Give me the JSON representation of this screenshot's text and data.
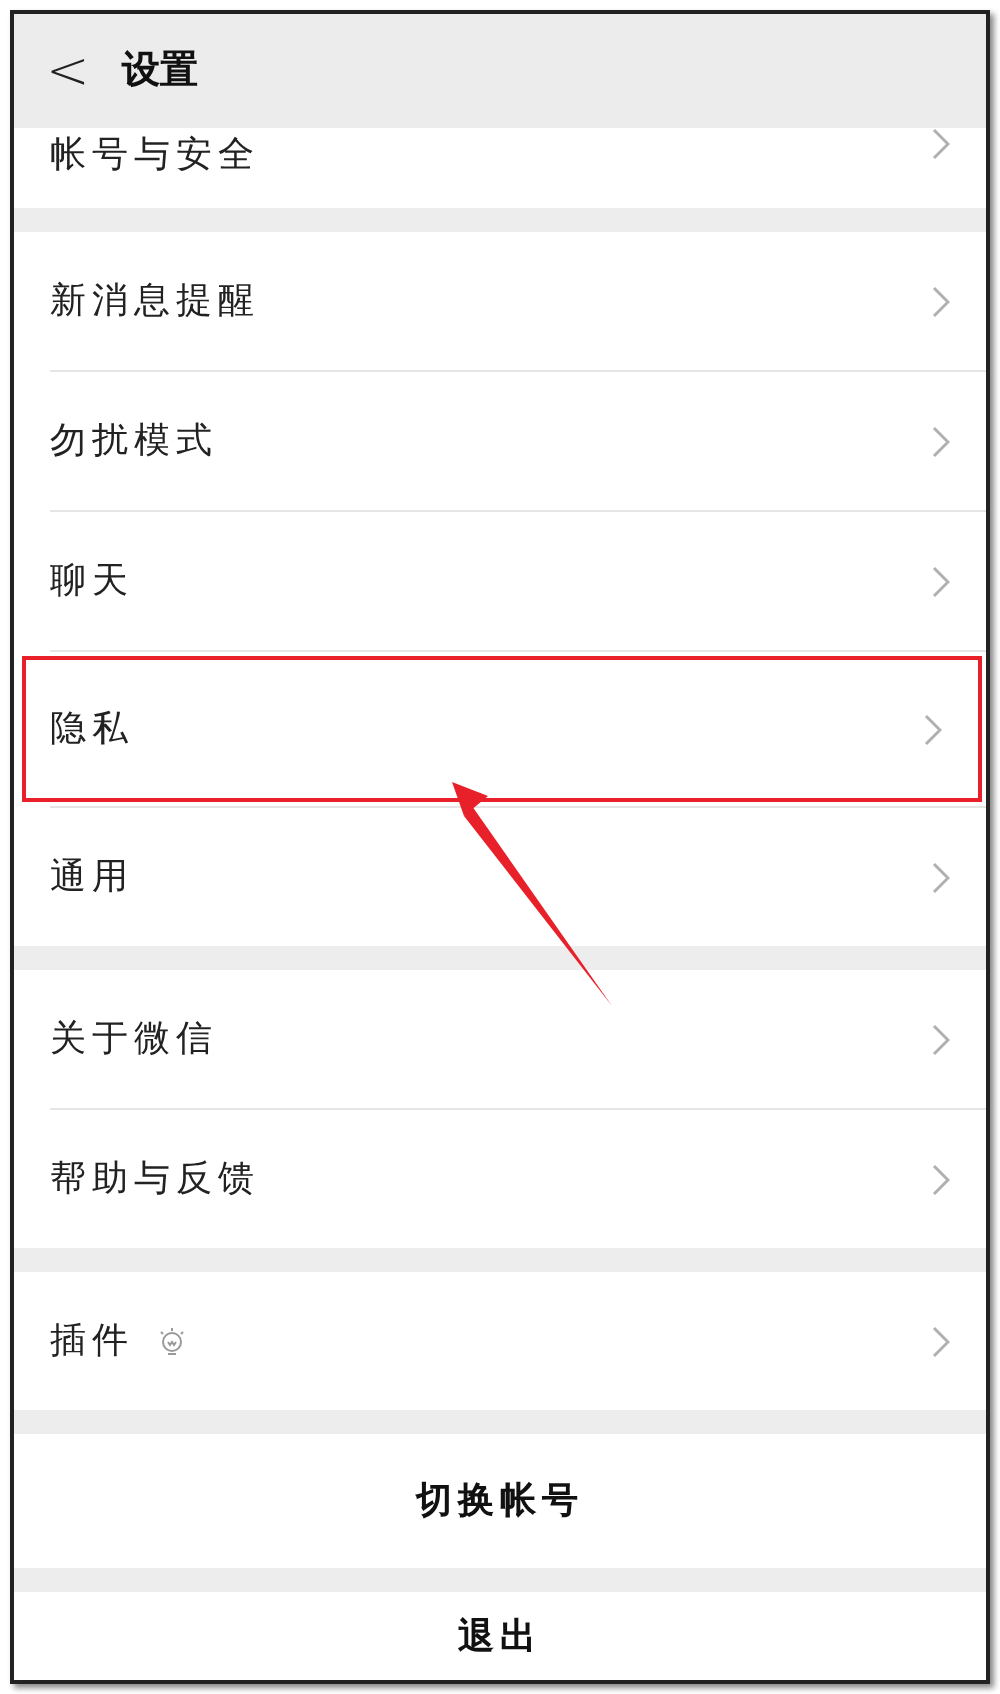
{
  "header": {
    "back": "<",
    "title": "设置"
  },
  "groups": [
    {
      "items": [
        {
          "label": "帐号与安全",
          "kind": "cut",
          "highlighted": false
        }
      ]
    },
    {
      "items": [
        {
          "label": "新消息提醒",
          "kind": "plain",
          "highlighted": false
        },
        {
          "label": "勿扰模式",
          "kind": "plain",
          "highlighted": false
        },
        {
          "label": "聊天",
          "kind": "plain",
          "highlighted": false
        },
        {
          "label": "隐私",
          "kind": "plain",
          "highlighted": true
        },
        {
          "label": "通用",
          "kind": "plain",
          "highlighted": false
        }
      ]
    },
    {
      "items": [
        {
          "label": "关于微信",
          "kind": "plain",
          "highlighted": false
        },
        {
          "label": "帮助与反馈",
          "kind": "plain",
          "highlighted": false
        }
      ]
    },
    {
      "items": [
        {
          "label": "插件",
          "kind": "with_icon",
          "highlighted": false
        }
      ]
    }
  ],
  "buttons": [
    {
      "label": "切换帐号"
    },
    {
      "label": "退出"
    }
  ]
}
